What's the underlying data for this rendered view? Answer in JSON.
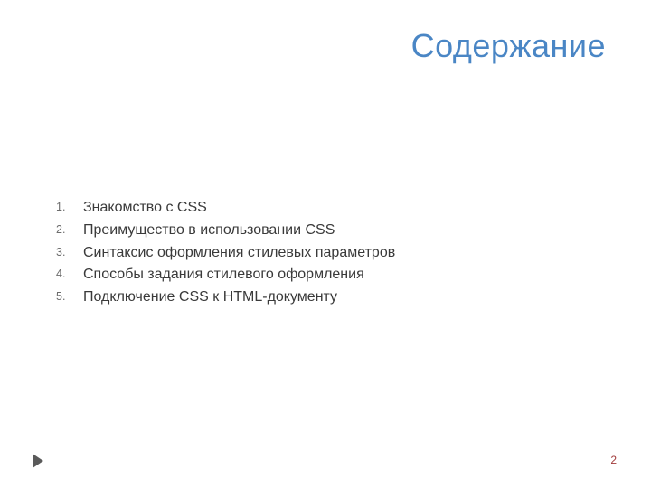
{
  "title": "Содержание",
  "items": [
    "Знакомство с CSS",
    "Преимущество в использовании CSS",
    "Синтаксис оформления стилевых параметров",
    "Способы задания стилевого оформления",
    "Подключение CSS к HTML-документу"
  ],
  "page_number": "2"
}
